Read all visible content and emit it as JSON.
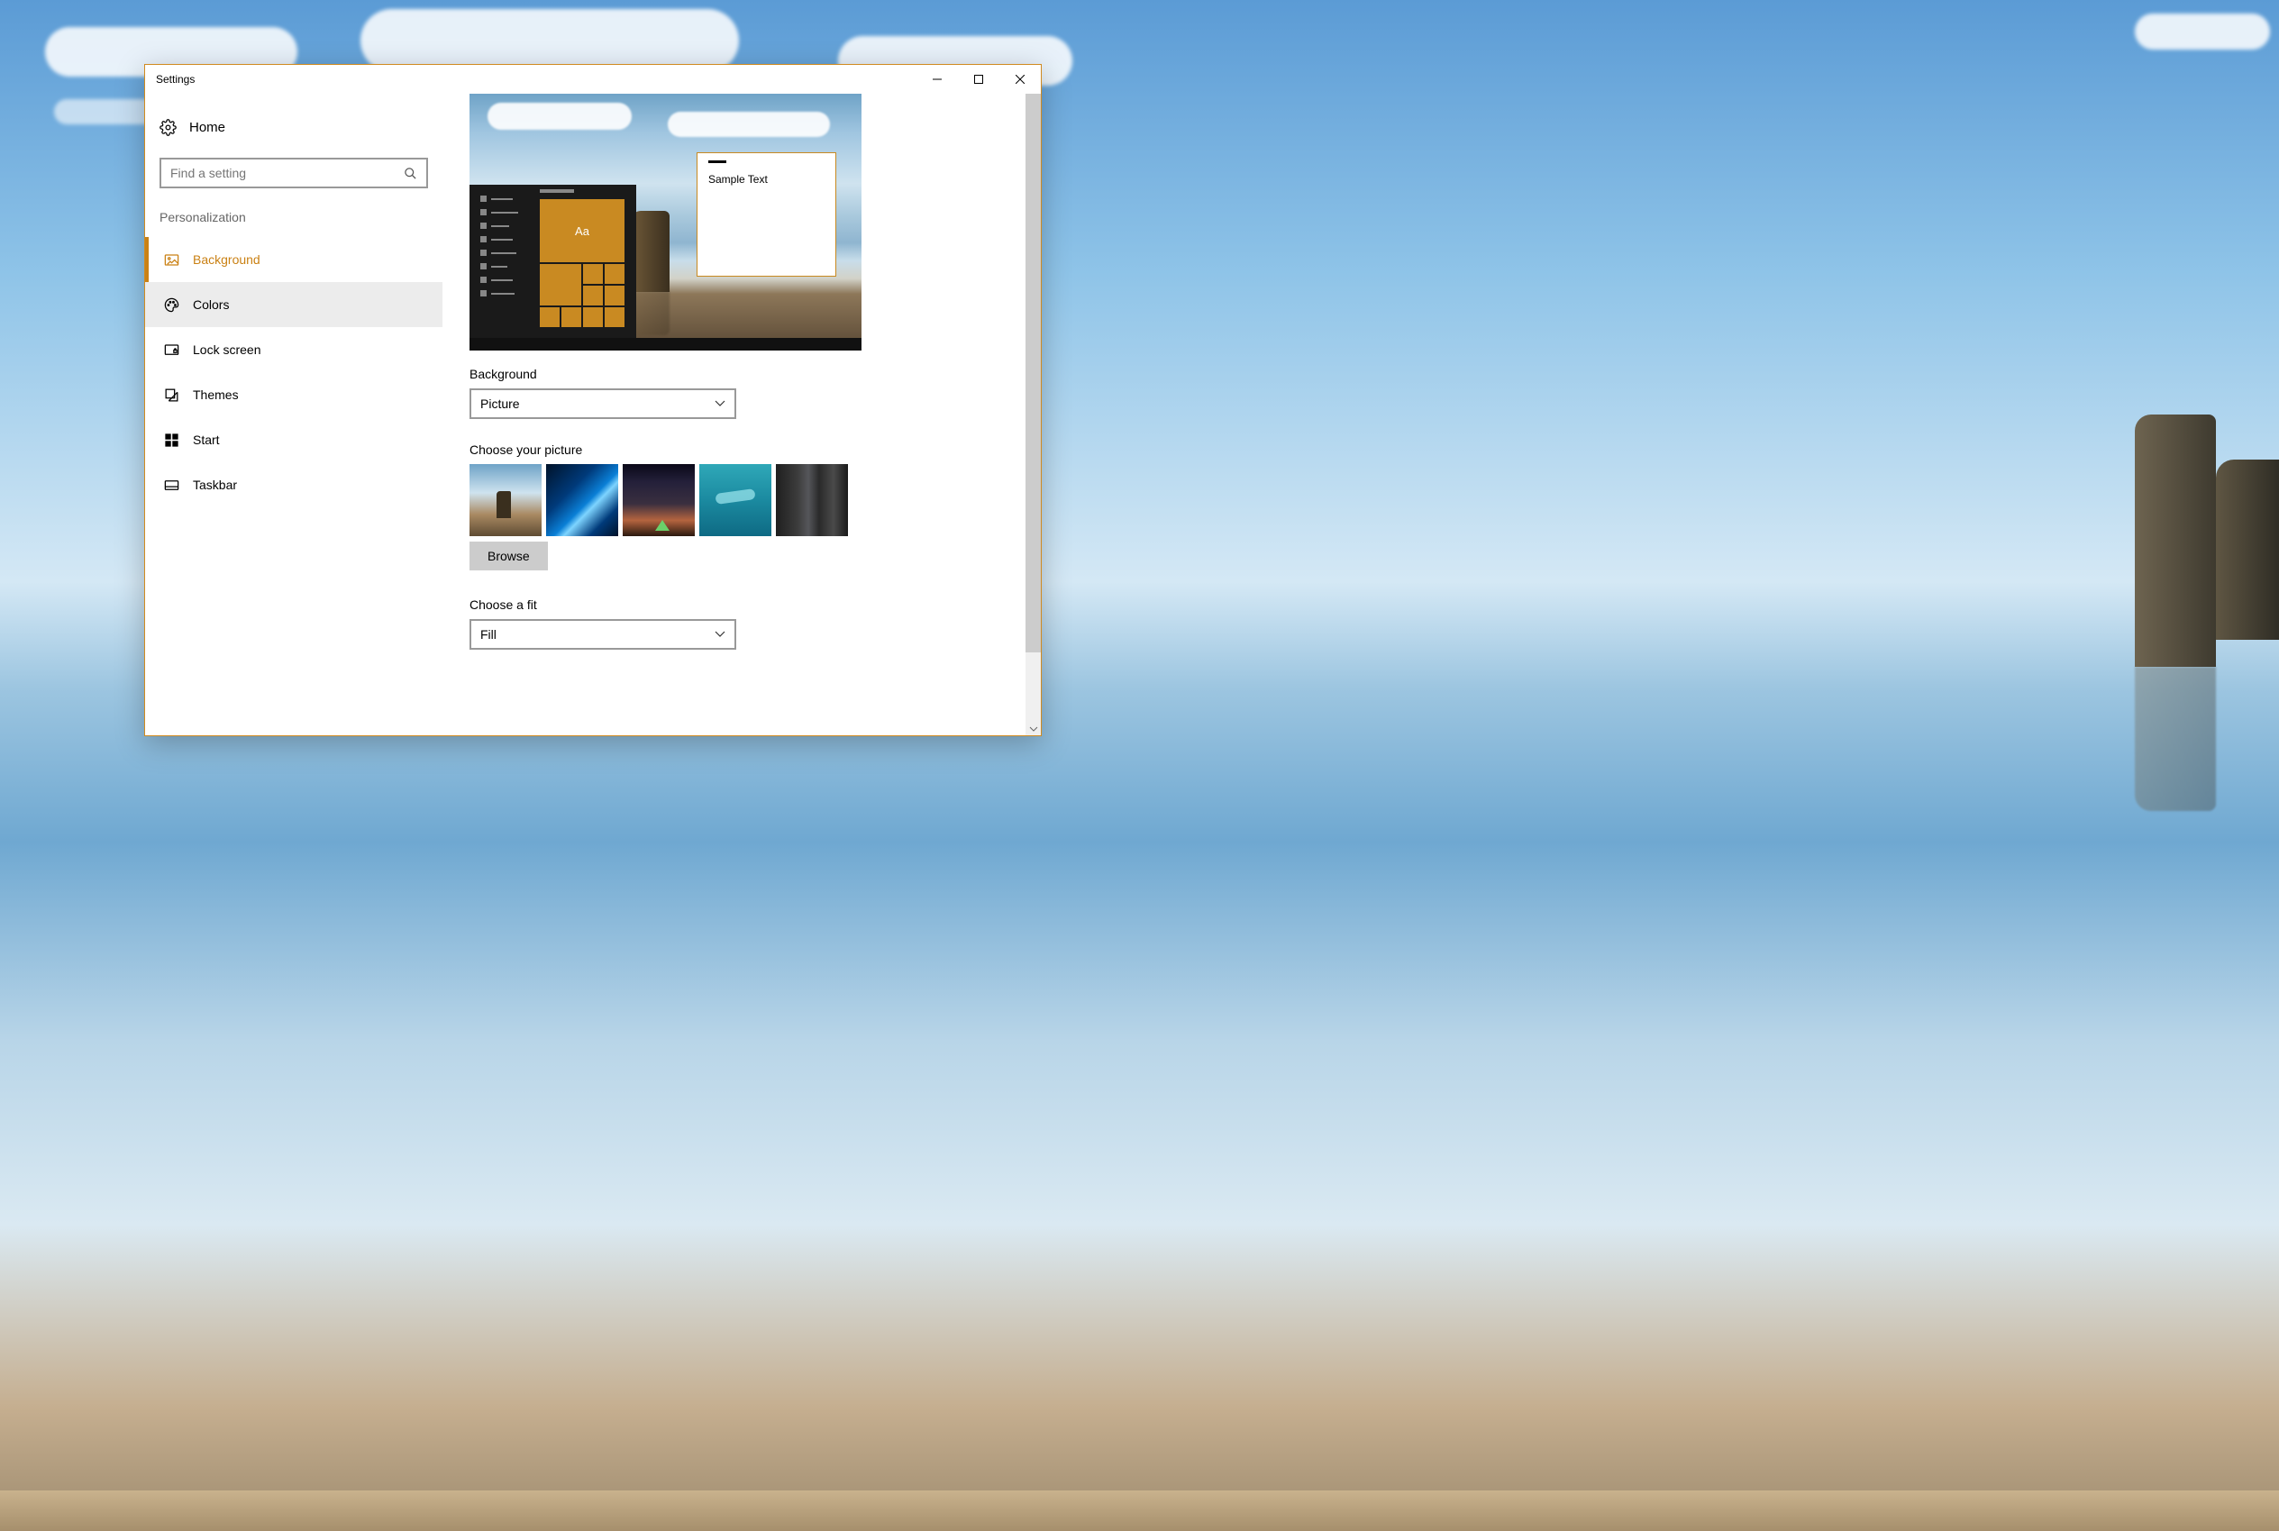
{
  "window": {
    "title": "Settings"
  },
  "sidebar": {
    "home": "Home",
    "search_placeholder": "Find a setting",
    "section": "Personalization",
    "items": [
      {
        "label": "Background"
      },
      {
        "label": "Colors"
      },
      {
        "label": "Lock screen"
      },
      {
        "label": "Themes"
      },
      {
        "label": "Start"
      },
      {
        "label": "Taskbar"
      }
    ]
  },
  "preview": {
    "sample_text": "Sample Text",
    "tile_text": "Aa"
  },
  "main": {
    "background_label": "Background",
    "background_value": "Picture",
    "choose_picture_label": "Choose your picture",
    "browse_label": "Browse",
    "fit_label": "Choose a fit",
    "fit_value": "Fill"
  },
  "accent_color": "#ca8114"
}
